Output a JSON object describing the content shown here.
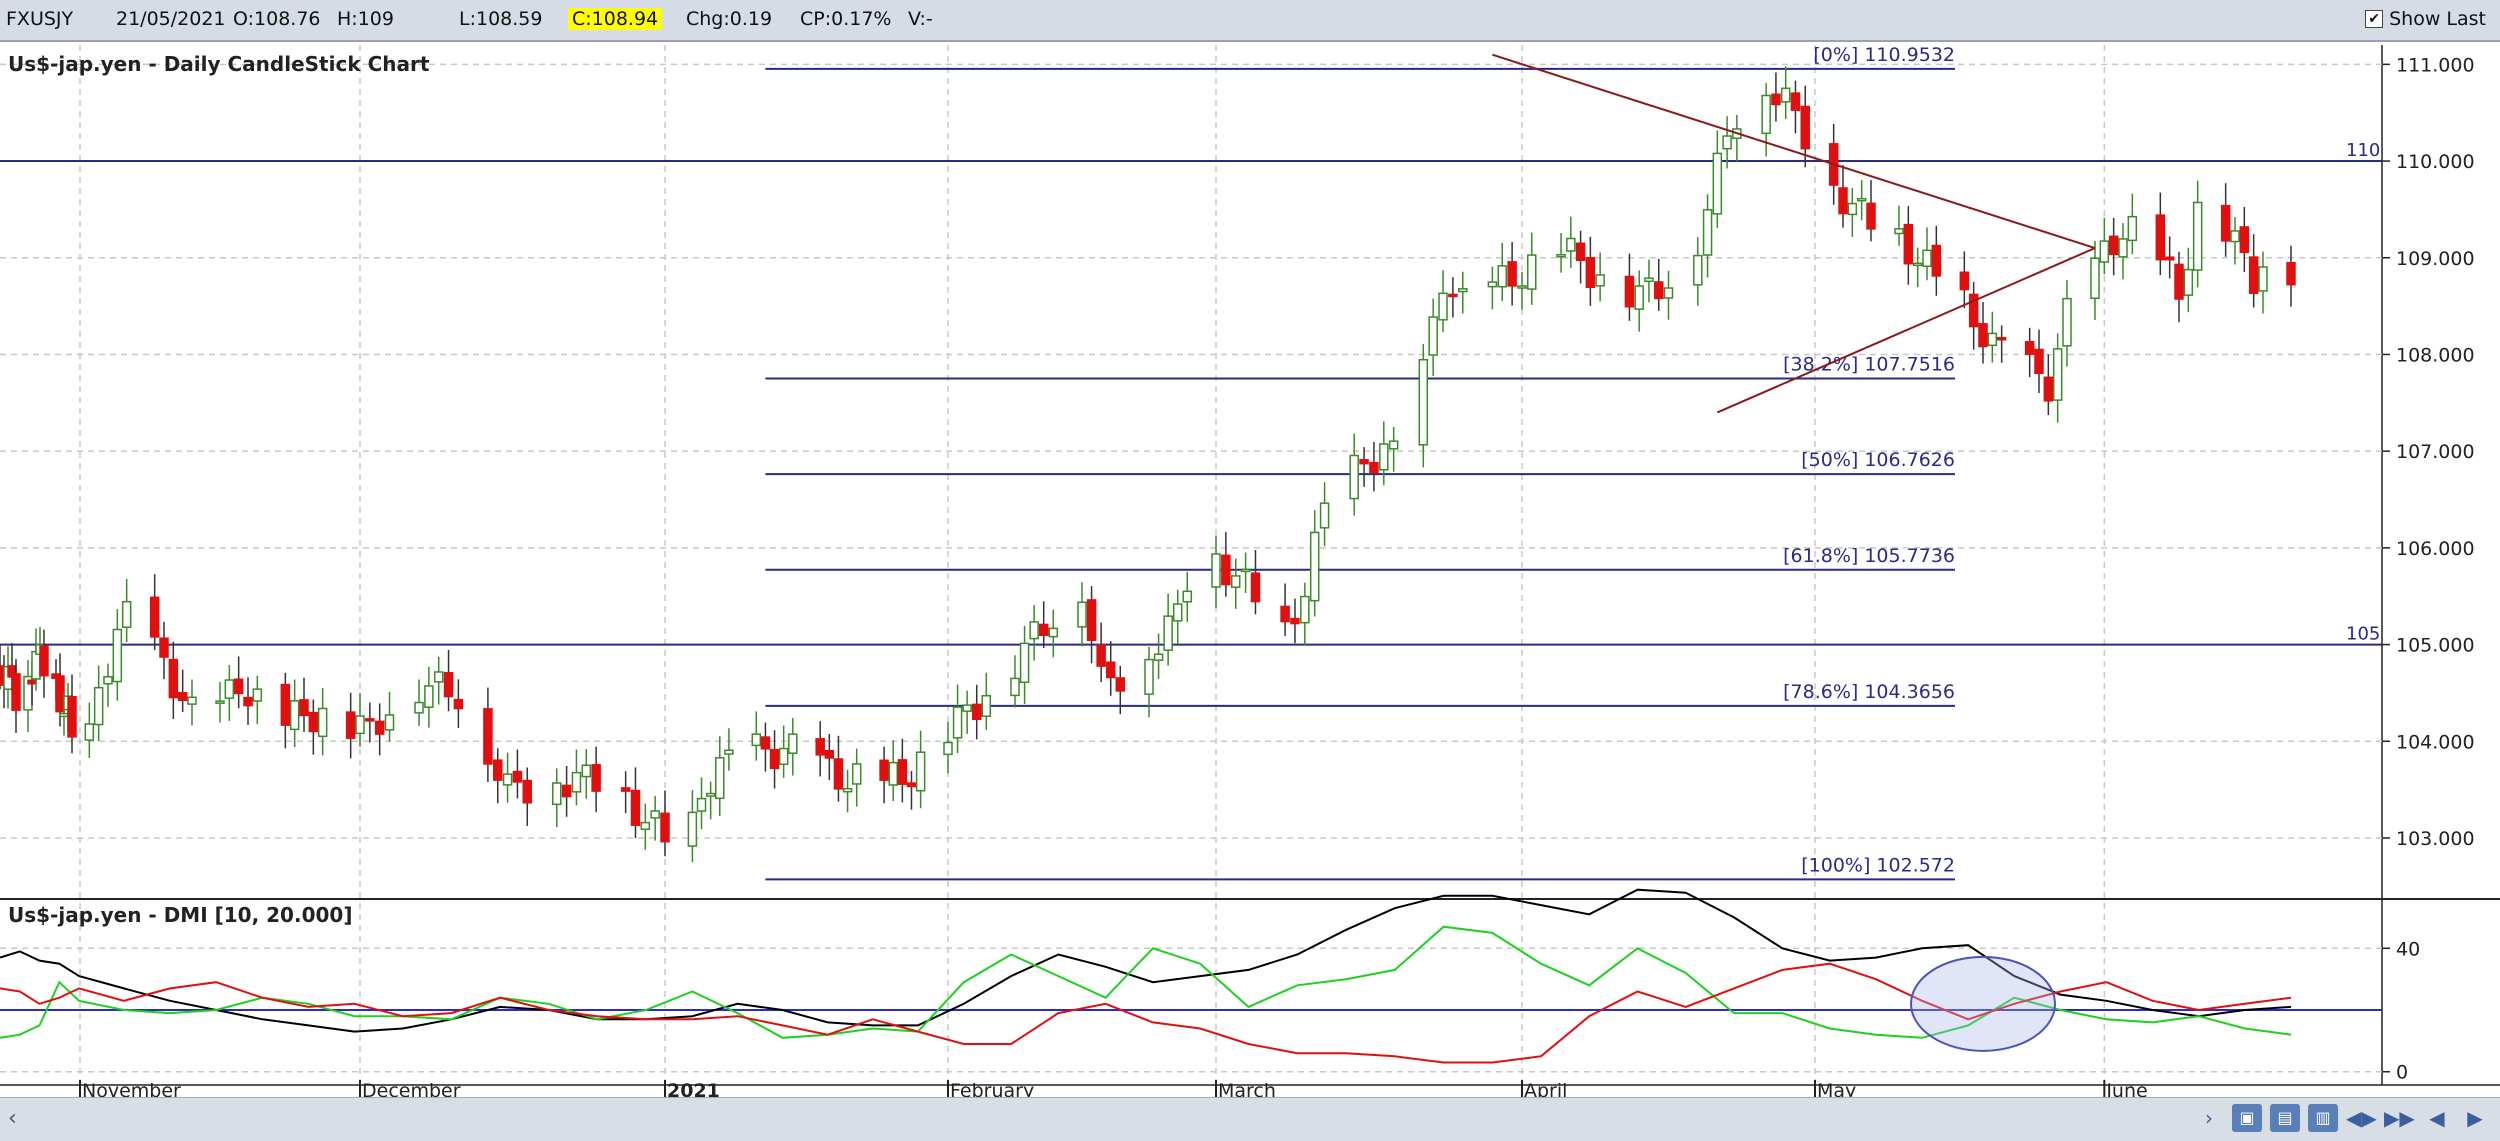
{
  "topbar": {
    "symbol": "FXUSJY",
    "date": "21/05/2021",
    "open": "O:108.76",
    "high": "H:109",
    "low": "L:108.59",
    "close": "C:108.94",
    "change": "Chg:0.19",
    "change_pct": "CP:0.17%",
    "volume": "V:-",
    "show_last_label": "Show Last",
    "show_last_checked": true
  },
  "chart_data": [
    {
      "type": "candlestick",
      "title": "Us$-jap.yen - Daily CandleStick Chart",
      "ylim": [
        102.4,
        111.2
      ],
      "y_ticks": [
        "103.000",
        "104.000",
        "105.000",
        "106.000",
        "107.000",
        "108.000",
        "109.000",
        "110.000",
        "111.000"
      ],
      "x_month_labels": [
        "November",
        "December",
        "2021",
        "February",
        "March",
        "April",
        "May",
        "June"
      ],
      "horizontal_levels": [
        {
          "value": 110,
          "label": "110"
        },
        {
          "value": 105,
          "label": "105"
        }
      ],
      "fibonacci_levels": [
        {
          "label": "[0%] 110.9532",
          "value": 110.9532
        },
        {
          "label": "[38.2%] 107.7516",
          "value": 107.7516
        },
        {
          "label": "[50%] 106.7626",
          "value": 106.7626
        },
        {
          "label": "[61.8%] 105.7736",
          "value": 105.7736
        },
        {
          "label": "[78.6%] 104.3656",
          "value": 104.3656
        },
        {
          "label": "[100%] 102.572",
          "value": 102.572
        }
      ],
      "triangle_apex": {
        "date": "2021-05-31",
        "value": 109.1
      },
      "triangle_upper_start": {
        "date": "2021-03-29",
        "value": 111.1
      },
      "triangle_lower_start": {
        "date": "2021-04-21",
        "value": 107.4
      },
      "colors": {
        "up": "#3a8a2a",
        "down": "#e01010",
        "level_line": "#2a2a8a",
        "trendline": "#8b1a1a"
      }
    },
    {
      "type": "line",
      "title": "Us$-jap.yen - DMI [10, 20.000]",
      "ylim": [
        -3,
        55
      ],
      "y_ticks": [
        "0",
        "40"
      ],
      "reference_line": 20,
      "series": [
        {
          "color": "#000000",
          "values": [
            37,
            39,
            36,
            35,
            31,
            27,
            23,
            20,
            17,
            15,
            13,
            14,
            17,
            21,
            20,
            17,
            17,
            18,
            22,
            20,
            16,
            15,
            15,
            22,
            31,
            38,
            34,
            29,
            31,
            33,
            38,
            46,
            53,
            57,
            57,
            54,
            51,
            59,
            58,
            50,
            40,
            36,
            37,
            40,
            41,
            31,
            25,
            23,
            20,
            18,
            20,
            21
          ]
        },
        {
          "color": "#1fd01f",
          "values": [
            11,
            12,
            15,
            29,
            23,
            20,
            19,
            20,
            24,
            22,
            18,
            18,
            17,
            24,
            22,
            17,
            20,
            26,
            19,
            11,
            12,
            14,
            13,
            29,
            38,
            31,
            24,
            40,
            35,
            21,
            28,
            30,
            33,
            47,
            45,
            35,
            28,
            40,
            32,
            19,
            19,
            14,
            12,
            11,
            15,
            24,
            20,
            17,
            16,
            18,
            14,
            12
          ]
        },
        {
          "color": "#e01010",
          "values": [
            27,
            26,
            22,
            24,
            27,
            23,
            27,
            29,
            24,
            21,
            22,
            18,
            19,
            24,
            20,
            18,
            17,
            17,
            18,
            15,
            12,
            17,
            13,
            9,
            9,
            19,
            22,
            16,
            14,
            9,
            6,
            6,
            5,
            3,
            3,
            5,
            18,
            26,
            21,
            27,
            33,
            35,
            30,
            23,
            17,
            22,
            26,
            29,
            23,
            20,
            22,
            24
          ]
        }
      ],
      "highlight_ellipse": {
        "date": "2021-05-19",
        "value": 22
      }
    }
  ],
  "navigation": {
    "scroll_left_icon": "chevron-left-icon",
    "buttons": [
      "chevron-right-icon",
      "save-icon",
      "save-as-icon",
      "import-icon",
      "scroll-lr-icon",
      "scroll-right-icon",
      "prev-icon",
      "next-icon"
    ]
  }
}
